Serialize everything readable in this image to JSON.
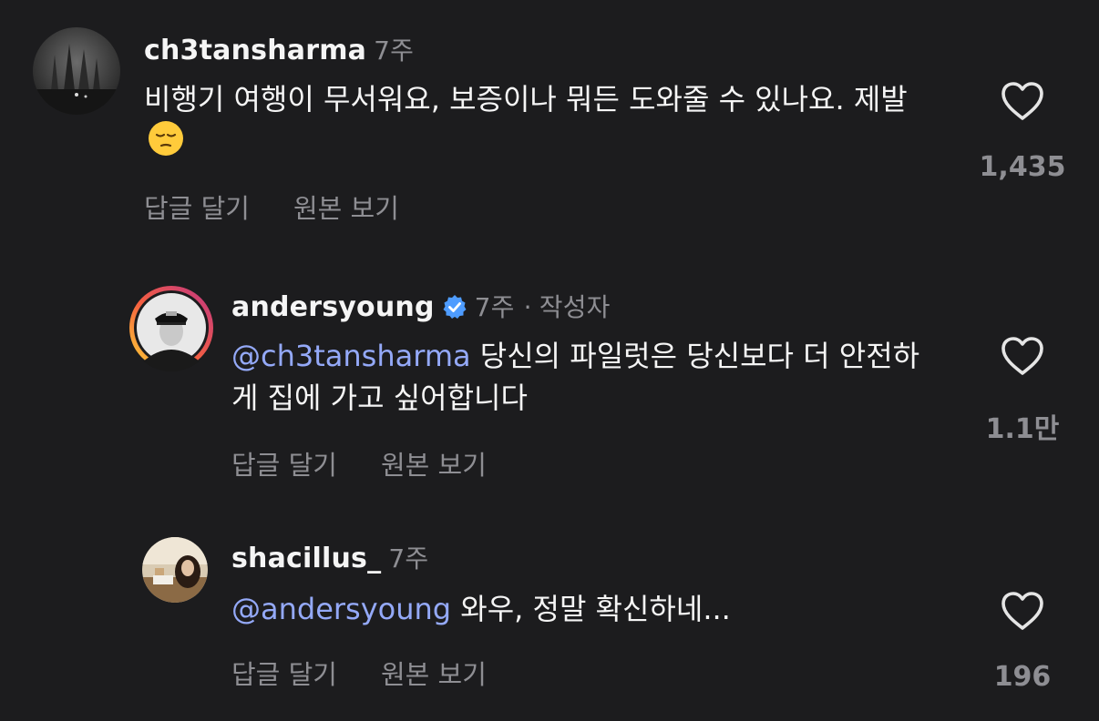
{
  "comments": [
    {
      "username": "ch3tansharma",
      "time": "7주",
      "text": "비행기 여행이 무서워요, 보증이나 뭐든 도와줄 수 있나요. 제발",
      "emoji": "pensive-face",
      "reply_label": "답글 달기",
      "translate_label": "원본 보기",
      "likes": "1,435"
    },
    {
      "username": "andersyoung",
      "verified": true,
      "time": "7주",
      "author_tag": "작성자",
      "mention": "@ch3tansharma",
      "text": "당신의 파일럿은 당신보다 더 안전하게 집에 가고 싶어합니다",
      "reply_label": "답글 달기",
      "translate_label": "원본 보기",
      "likes": "1.1만"
    },
    {
      "username": "shacillus_",
      "time": "7주",
      "mention": "@andersyoung",
      "text": "와우, 정말 확신하네...",
      "reply_label": "답글 달기",
      "translate_label": "원본 보기",
      "likes": "196"
    }
  ],
  "colors": {
    "background": "#1c1c1e",
    "mention": "#94a9f8",
    "secondary": "#8e8e93",
    "verified": "#4e9cff"
  },
  "icons": [
    "heart-icon",
    "verified-badge-icon"
  ]
}
